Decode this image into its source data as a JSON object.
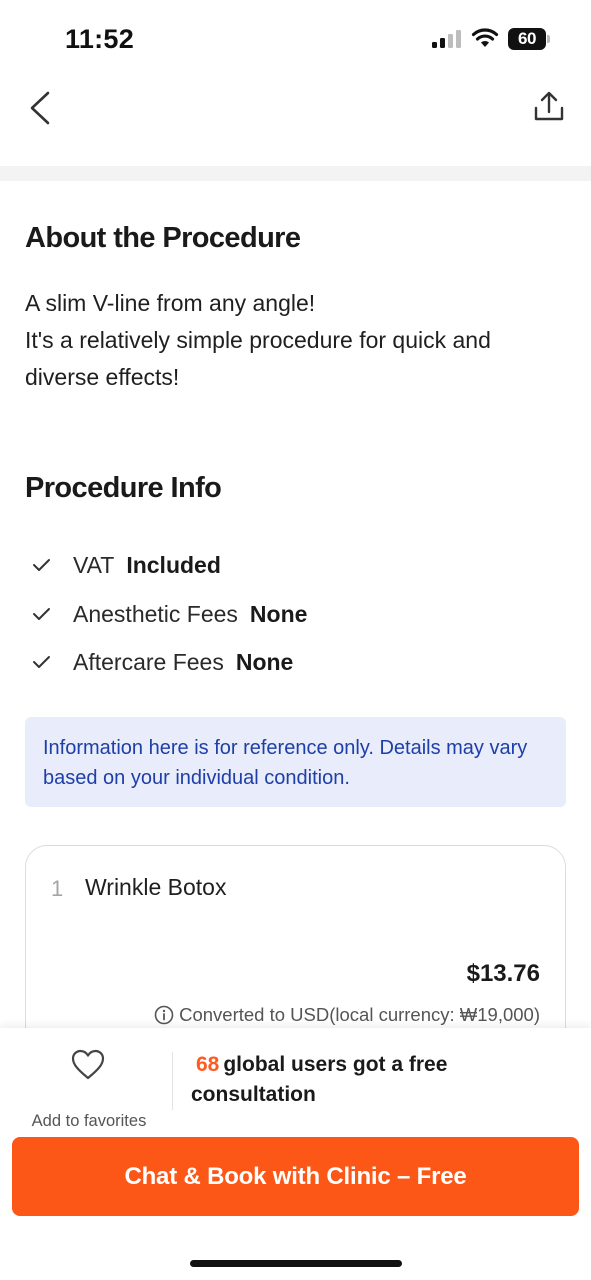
{
  "status_bar": {
    "time": "11:52",
    "battery": "60",
    "icons": [
      "cellular-signal-icon",
      "wifi-icon",
      "battery-icon"
    ]
  },
  "nav": {
    "icons": [
      "chevron-left-icon",
      "share-icon"
    ]
  },
  "about": {
    "title": "About the Procedure",
    "text": "A slim V-line from any angle!\nIt's a relatively simple procedure for quick and diverse effects!"
  },
  "procedure_info": {
    "title": "Procedure Info",
    "items": [
      {
        "label": "VAT",
        "value": "Included"
      },
      {
        "label": "Anesthetic Fees",
        "value": "None"
      },
      {
        "label": "Aftercare Fees",
        "value": "None"
      }
    ]
  },
  "notice": {
    "text": "Information here is for reference only. Details may vary based on your individual condition."
  },
  "option_card": {
    "index": "1",
    "name": "Wrinkle Botox",
    "price": "$13.76",
    "conversion_note": "Converted to USD(local currency: ₩19,000)"
  },
  "bottom_bar": {
    "favorite_label": "Add to favorites",
    "consult_count": "68",
    "consult_text": "global users got a free consultation",
    "cta_label": "Chat & Book with Clinic – Free"
  },
  "colors": {
    "accent": "#fc5716",
    "count_highlight": "#ff5a1f",
    "notice_bg": "#e8ecfb",
    "notice_text": "#1e3ea8"
  }
}
